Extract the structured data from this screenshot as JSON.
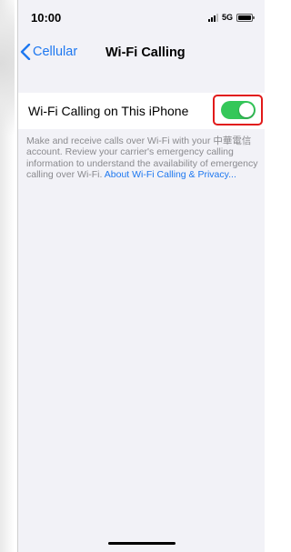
{
  "status_bar": {
    "time": "10:00",
    "network": "5G",
    "icons": [
      "signal-icon",
      "battery-icon"
    ]
  },
  "nav": {
    "back_label": "Cellular",
    "title": "Wi-Fi Calling",
    "back_icon": "chevron-left-icon"
  },
  "settings": {
    "wifi_calling_label": "Wi-Fi Calling on This iPhone",
    "wifi_calling_enabled": true
  },
  "footer": {
    "description": "Make and receive calls over Wi-Fi with your 中華電信 account. Review your carrier's emergency calling information to understand the availability of emergency calling over Wi-Fi.",
    "link_text": "About Wi-Fi Calling & Privacy..."
  },
  "colors": {
    "accent": "#1e78f0",
    "toggle_on": "#34c759",
    "highlight_box": "#e11a1a",
    "grouped_background": "#f2f2f7",
    "secondary_text": "#8a8a8e"
  }
}
